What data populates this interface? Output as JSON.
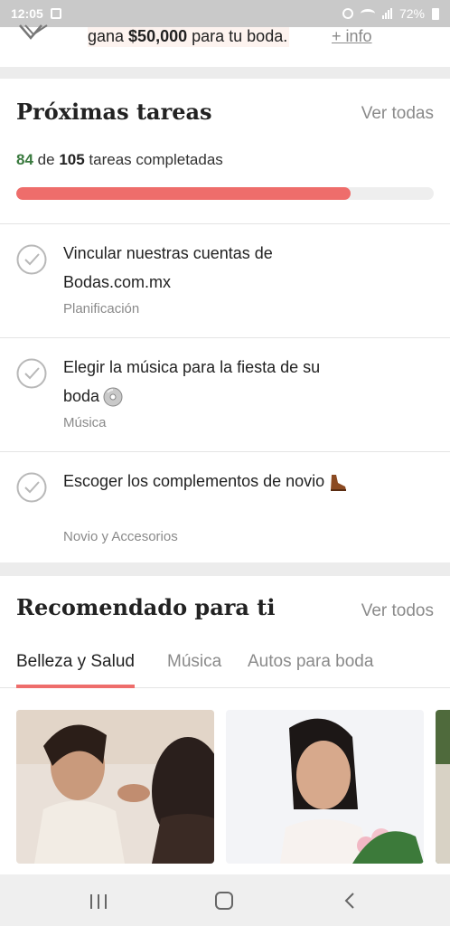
{
  "status_bar": {
    "time": "12:05",
    "battery": "72%"
  },
  "banner": {
    "promo_prefix": "gana ",
    "promo_amount": "$50,000",
    "promo_suffix": " para tu boda.",
    "more_link": "+ info"
  },
  "tasks": {
    "title": "Próximas tareas",
    "see_all": "Ver todas",
    "completed": "84",
    "of_word": "de",
    "total": "105",
    "suffix": "tareas completadas",
    "progress_fraction": 0.8,
    "items": [
      {
        "title": "Vincular nuestras cuentas de Bodas.com.mx",
        "category": "Planificación",
        "emoji": ""
      },
      {
        "title": "Elegir la música para la fiesta de su boda",
        "category": "Música",
        "emoji": "cd-icon"
      },
      {
        "title": "Escoger los complementos de novio",
        "category": "Novio y Accesorios",
        "emoji": "shoe-icon"
      }
    ]
  },
  "recommended": {
    "title": "Recomendado para ti",
    "see_all": "Ver todos",
    "tabs": [
      "Belleza y Salud",
      "Música",
      "Autos para boda"
    ],
    "active_tab": 0
  },
  "colors": {
    "accent": "#ee6d6b",
    "done_green": "#3a7a3f",
    "muted": "#8a8a8a"
  }
}
